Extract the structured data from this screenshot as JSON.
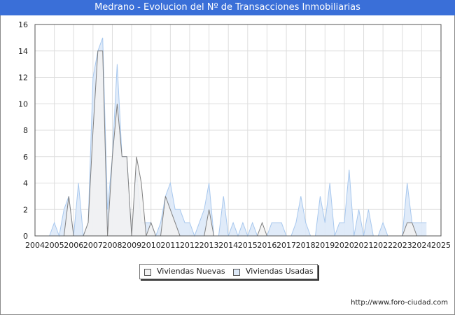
{
  "header": {
    "title": "Medrano - Evolucion del Nº de Transacciones Inmobiliarias"
  },
  "footer": {
    "url": "http://www.foro-ciudad.com"
  },
  "legend": {
    "items": [
      {
        "label": "Viviendas Nuevas",
        "color": "#f2f2f2"
      },
      {
        "label": "Viviendas Usadas",
        "color": "#dde9f8"
      }
    ]
  },
  "chart_data": {
    "type": "area",
    "title": "Medrano - Evolucion del Nº de Transacciones Inmobiliarias",
    "xlabel": "",
    "ylabel": "",
    "grid": true,
    "legend_position": "bottom-center",
    "x_ticks": [
      "2004",
      "2005",
      "2006",
      "2007",
      "2008",
      "2009",
      "2010",
      "2011",
      "2012",
      "2013",
      "2014",
      "2015",
      "2016",
      "2017",
      "2018",
      "2019",
      "2020",
      "2021",
      "2022",
      "2023",
      "2024",
      "2025"
    ],
    "xlim": [
      2004,
      2025
    ],
    "ylim": [
      0,
      16
    ],
    "y_ticks": [
      0,
      2,
      4,
      6,
      8,
      10,
      12,
      14,
      16
    ],
    "colors": {
      "nuevas_line": "#808080",
      "nuevas_fill": "#f2f2f2",
      "usadas_line": "#a8c8ee",
      "usadas_fill": "#dde9f8",
      "grid": "#dddddd"
    },
    "series": [
      {
        "name": "Viviendas Usadas",
        "x_start": 2004.75,
        "step": 0.25,
        "values": [
          0,
          1,
          0,
          2,
          3,
          0,
          4,
          0,
          1,
          12,
          14,
          15,
          2,
          6,
          13,
          6,
          6,
          0,
          5,
          1,
          1,
          1,
          0,
          1,
          3,
          4,
          2,
          2,
          1,
          1,
          0,
          1,
          2,
          4,
          0,
          0,
          3,
          0,
          1,
          0,
          1,
          0,
          1,
          0,
          0,
          0,
          1,
          1,
          1,
          0,
          0,
          1,
          3,
          1,
          0,
          0,
          3,
          1,
          4,
          0,
          1,
          1,
          5,
          0,
          2,
          0,
          2,
          0,
          0,
          1,
          0,
          0,
          0,
          0,
          4,
          1,
          1,
          1,
          1
        ]
      },
      {
        "name": "Viviendas Nuevas",
        "x_start": 2004.75,
        "step": 0.25,
        "values": [
          0,
          0,
          0,
          0,
          3,
          0,
          0,
          0,
          1,
          8,
          14,
          14,
          0,
          6,
          10,
          6,
          6,
          0,
          6,
          4,
          0,
          1,
          0,
          0,
          3,
          2,
          1,
          0,
          0,
          0,
          0,
          0,
          0,
          2,
          0,
          0,
          0,
          0,
          0,
          0,
          0,
          0,
          0,
          0,
          1,
          0,
          0,
          0,
          0,
          0,
          0,
          0,
          0,
          0,
          0,
          0,
          0,
          0,
          0,
          0,
          0,
          0,
          0,
          0,
          0,
          0,
          0,
          0,
          0,
          0,
          0,
          0,
          0,
          0,
          1,
          1,
          0
        ]
      }
    ]
  }
}
